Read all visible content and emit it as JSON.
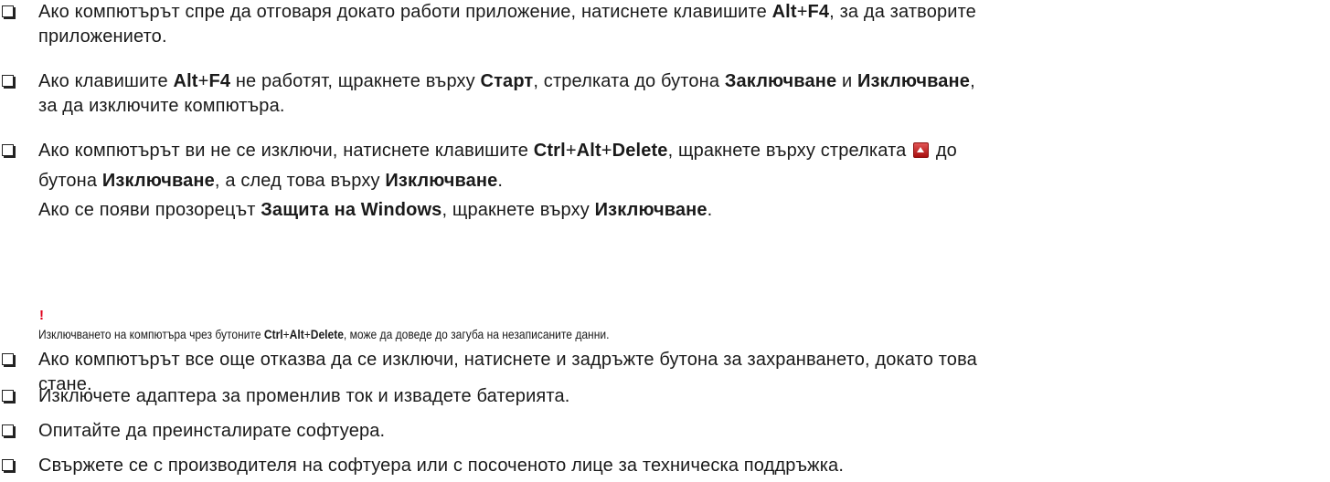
{
  "items": [
    {
      "lines": [
        [
          "Ако компютърът спре да отговаря докато работи приложение, натиснете клавишите ",
          {
            "b": "Alt"
          },
          "+",
          {
            "b": "F4"
          },
          ", за да затворите"
        ],
        [
          "приложението."
        ]
      ]
    },
    {
      "lines": [
        [
          "Ако клавишите ",
          {
            "b": "Alt"
          },
          "+",
          {
            "b": "F4"
          },
          " не работят, щракнете върху ",
          {
            "b": "Старт"
          },
          ", стрелката до бутона ",
          {
            "b": "Заключване"
          },
          " и ",
          {
            "b": "Изключване"
          },
          ","
        ],
        [
          "за да изключите компютъра."
        ]
      ]
    },
    {
      "lines": [
        [
          "Ако компютърът ви не се изключи, натиснете клавишите ",
          {
            "b": "Ctrl"
          },
          "+",
          {
            "b": "Alt"
          },
          "+",
          {
            "b": "Delete"
          },
          ", щракнете върху стрелката ",
          {
            "icon": "shutdown-arrow-icon"
          },
          " до"
        ],
        [
          "бутона ",
          {
            "b": "Изключване"
          },
          ", а след това върху ",
          {
            "b": "Изключване"
          },
          "."
        ],
        [
          "Ако се появи прозорецът ",
          {
            "b": "Защита на Windows"
          },
          ", щракнете върху ",
          {
            "b": "Изключване"
          },
          "."
        ]
      ]
    },
    {
      "lines": [
        [
          "Ако компютърът все още отказва да се изключи, натиснете и задръжте бутона за захранването, докато това"
        ],
        [
          "стане."
        ]
      ]
    },
    {
      "lines": [
        [
          "Изключете адаптера за променлив ток и извадете батерията."
        ]
      ]
    },
    {
      "lines": [
        [
          "Опитайте да преинсталирате софтуера."
        ]
      ]
    },
    {
      "lines": [
        [
          "Свържете се с производителя на софтуера или с посоченото лице за техническа поддръжка."
        ]
      ]
    }
  ],
  "warning": {
    "mark": "!",
    "segments": [
      "Изключването на компютъра чрез бутоните ",
      {
        "b": "Ctrl"
      },
      "+",
      {
        "b": "Alt"
      },
      "+",
      {
        "b": "Delete"
      },
      ", може да доведе до загуба на незаписаните данни."
    ]
  }
}
